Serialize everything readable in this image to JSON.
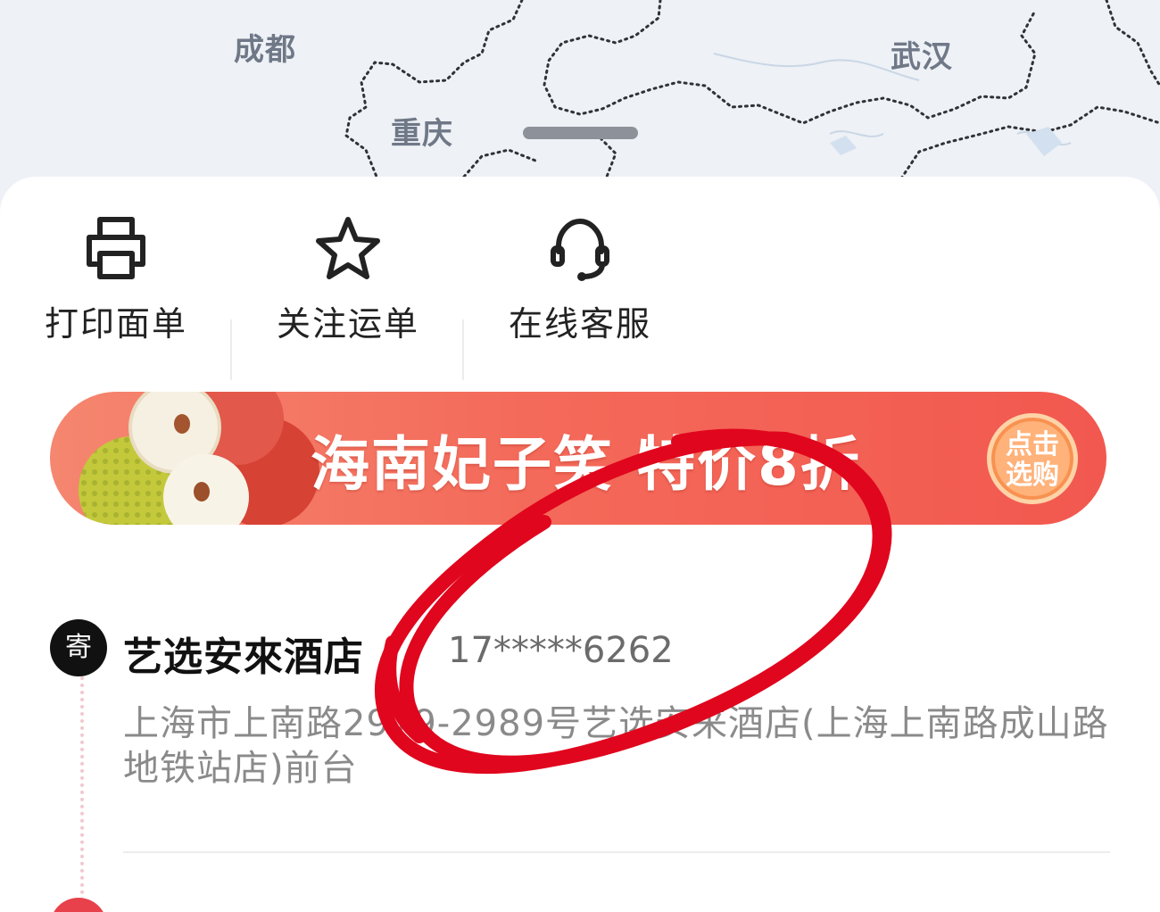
{
  "map": {
    "cities": [
      "成都",
      "重庆",
      "武汉"
    ]
  },
  "actions": [
    {
      "label": "打印面单",
      "icon": "printer-icon"
    },
    {
      "label": "关注运单",
      "icon": "star-icon"
    },
    {
      "label": "在线客服",
      "icon": "headset-icon"
    }
  ],
  "banner": {
    "title": "海南妃子笑 特价8折",
    "cta_line1": "点击",
    "cta_line2": "选购",
    "icon": "lychee-image"
  },
  "sender": {
    "badge": "寄",
    "name": "艺选安來酒店",
    "phone": "17*****6262",
    "address": "上海市上南路2979-2989号艺选安来酒店(上海上南路成山路地铁站店)前台"
  },
  "colors": {
    "accent_red": "#e8414c",
    "banner_red": "#f46a5a",
    "annotation_red": "#e0061d"
  }
}
